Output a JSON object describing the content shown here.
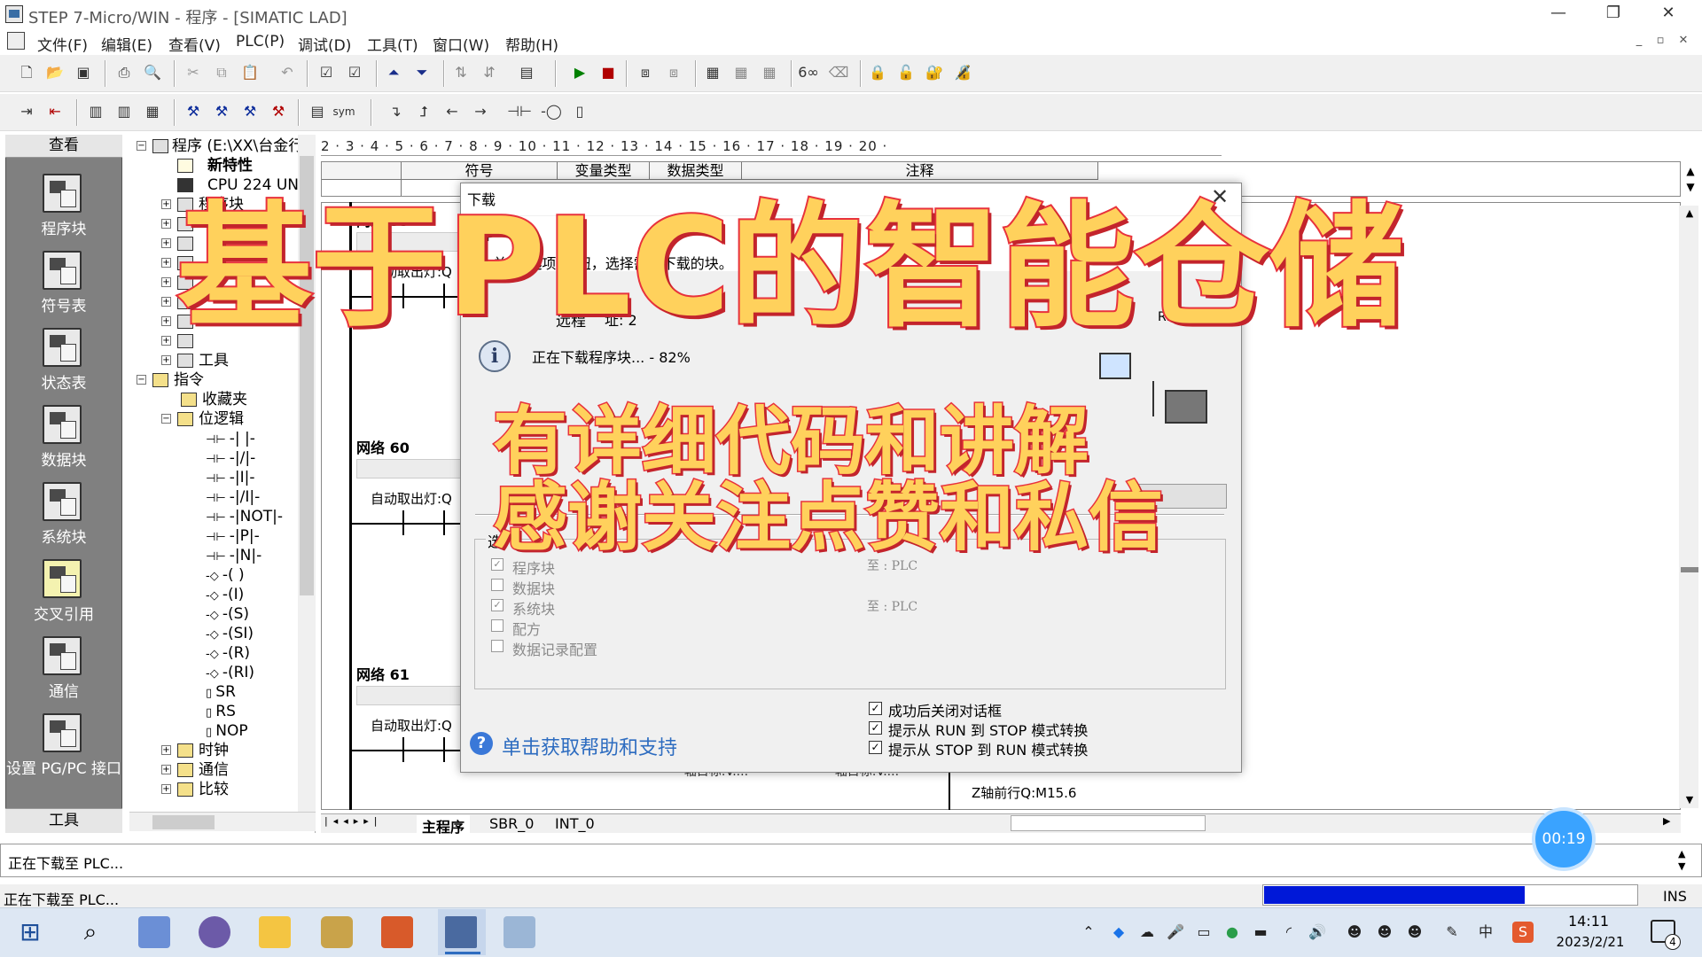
{
  "window": {
    "title": "STEP 7-Micro/WIN - 程序 - [SIMATIC LAD]",
    "minimize": "—",
    "restore": "❐",
    "close": "✕"
  },
  "menu": [
    "文件(F)",
    "编辑(E)",
    "查看(V)",
    "PLC(P)",
    "调试(D)",
    "工具(T)",
    "窗口(W)",
    "帮助(H)"
  ],
  "nav": {
    "header": "查看",
    "footer": "工具",
    "items": [
      "程序块",
      "符号表",
      "状态表",
      "数据块",
      "系统块",
      "交叉引用",
      "通信",
      "设置 PG/PC 接口"
    ]
  },
  "tree": {
    "root": "程序 (E:\\XX\\台金行",
    "new_feature": "新特性",
    "cpu": "CPU 224 UN F",
    "blocks": "程序块",
    "tools": "工具",
    "instructions": "指令",
    "favorites": "收藏夹",
    "bitlogic": "位逻辑",
    "contacts": [
      "-| |-",
      "-|/|-",
      "-|I|-",
      "-|/I|-",
      "-|NOT|-",
      "-|P|-",
      "-|N|-",
      "-( )",
      "-(I)",
      "-(S)",
      "-(SI)",
      "-(R)",
      "-(RI)",
      "SR",
      "RS",
      "NOP"
    ],
    "clock": "时钟",
    "comm": "通信",
    "compare": "比较"
  },
  "ruler": "2 · 3 · 4 · 5 · 6 · 7 · 8 · 9 · 10 · 11 · 12 · 13 · 14 · 15 · 16 · 17 · 18 · 19 · 20 ·",
  "symbol_table": {
    "cols": [
      "符号",
      "变量类型",
      "数据类型",
      "注释"
    ]
  },
  "ladder": {
    "networks": [
      "网络 59",
      "网络 60",
      "网络 61"
    ],
    "labels": [
      "自动取出灯:Q",
      "自动取出灯:Q",
      "自动取出灯:Q"
    ],
    "bottom_label": "Z轴前行Q:M15.6",
    "partial_labels": [
      "~轴目标:V....",
      "~轴目标:V...."
    ]
  },
  "tabs": [
    "主程序",
    "SBR_0",
    "INT_0"
  ],
  "output_text": "正在下载至 PLC...",
  "status": {
    "text": "正在下载至 PLC...",
    "progress": 0.7,
    "mode": "INS"
  },
  "dialog": {
    "title": "下载",
    "close": "✕",
    "instr": "单击\"选项\"按钮，选择需要下载的块。",
    "remote_label": "远程",
    "remote_addr": "址: 2",
    "version": "REL 02.01",
    "downloading": "正在下载程序块... - 82%",
    "options_label": "选",
    "options": [
      {
        "label": "程序块",
        "checked": true,
        "target": "至 : PLC"
      },
      {
        "label": "数据块",
        "checked": false,
        "target": ""
      },
      {
        "label": "系统块",
        "checked": true,
        "target": "至 : PLC"
      },
      {
        "label": "配方",
        "checked": false,
        "target": ""
      },
      {
        "label": "数据记录配置",
        "checked": false,
        "target": ""
      }
    ],
    "after": [
      "成功后关闭对话框",
      "提示从 RUN 到 STOP 模式转换",
      "提示从 STOP 到 RUN 模式转换"
    ],
    "help": "单击获取帮助和支持",
    "pp": "PP"
  },
  "overlay": {
    "title": "基于PLC的智能仓储",
    "line1": "有详细代码和讲解",
    "line2": "感谢关注点赞和私信"
  },
  "timer": "00:19",
  "taskbar": {
    "time": "14:11",
    "date": "2023/2/21",
    "notif": "4",
    "ime": "中"
  },
  "colors": {
    "accent": "#0018d8",
    "overlay_fill": "#ffd15c",
    "overlay_stroke": "#e8323c",
    "nav_bg": "#808080"
  }
}
